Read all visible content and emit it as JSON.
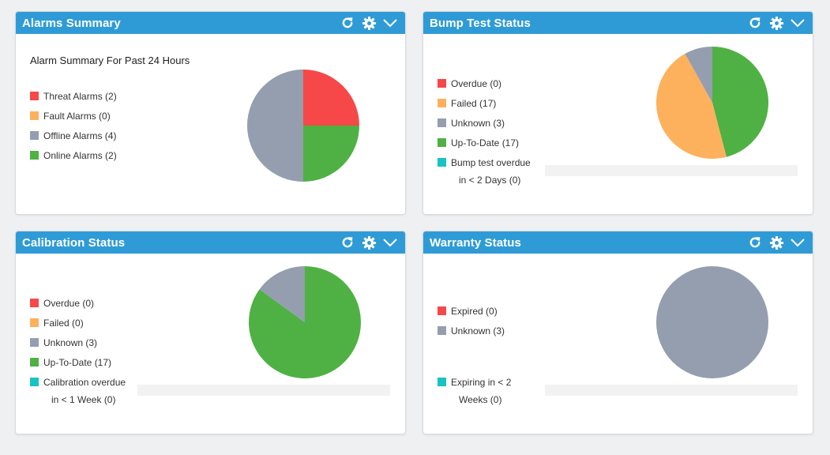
{
  "colors": {
    "header_bg": "#2f9bd6",
    "red": "#f64848",
    "orange": "#fdb15c",
    "gray": "#949eae",
    "green": "#4fb143",
    "teal": "#18c3c3"
  },
  "icons": {
    "refresh": "refresh-icon",
    "settings": "gear-icon",
    "collapse": "chevron-down-icon"
  },
  "panels": {
    "alarms": {
      "title": "Alarms Summary",
      "caption": "Alarm Summary For Past 24 Hours",
      "legend": [
        {
          "label": "Threat Alarms (2)",
          "color": "#f64848"
        },
        {
          "label": "Fault Alarms (0)",
          "color": "#fdb15c"
        },
        {
          "label": "Offline Alarms (4)",
          "color": "#949eae"
        },
        {
          "label": "Online Alarms (2)",
          "color": "#4fb143"
        }
      ]
    },
    "bump": {
      "title": "Bump Test Status",
      "legend": [
        {
          "label": "Overdue (0)",
          "color": "#f64848"
        },
        {
          "label": "Failed (17)",
          "color": "#fdb15c"
        },
        {
          "label": "Unknown (3)",
          "color": "#949eae"
        },
        {
          "label": "Up-To-Date (17)",
          "color": "#4fb143"
        },
        {
          "label": "Bump test overdue",
          "label2": "in < 2 Days (0)",
          "color": "#18c3c3"
        }
      ]
    },
    "calibration": {
      "title": "Calibration Status",
      "legend": [
        {
          "label": "Overdue (0)",
          "color": "#f64848"
        },
        {
          "label": "Failed (0)",
          "color": "#fdb15c"
        },
        {
          "label": "Unknown (3)",
          "color": "#949eae"
        },
        {
          "label": "Up-To-Date (17)",
          "color": "#4fb143"
        },
        {
          "label": "Calibration overdue",
          "label2": "in < 1 Week (0)",
          "color": "#18c3c3"
        }
      ]
    },
    "warranty": {
      "title": "Warranty Status",
      "legend": [
        {
          "label": "Expired (0)",
          "color": "#f64848"
        },
        {
          "label": "Unknown (3)",
          "color": "#949eae"
        },
        {
          "label": "Expiring in < 2",
          "label2": "Weeks (0)",
          "color": "#18c3c3"
        }
      ]
    }
  },
  "chart_data": [
    {
      "type": "pie",
      "slices": [
        {
          "label": "Threat Alarms",
          "value": 2,
          "color": "#f64848"
        },
        {
          "label": "Fault Alarms",
          "value": 0,
          "color": "#fdb15c"
        },
        {
          "label": "Offline Alarms",
          "value": 4,
          "color": "#949eae"
        },
        {
          "label": "Online Alarms",
          "value": 2,
          "color": "#4fb143"
        }
      ],
      "order": [
        "Threat Alarms",
        "Online Alarms",
        "Offline Alarms"
      ]
    },
    {
      "type": "pie",
      "slices": [
        {
          "label": "Overdue",
          "value": 0,
          "color": "#f64848"
        },
        {
          "label": "Failed",
          "value": 17,
          "color": "#fdb15c"
        },
        {
          "label": "Unknown",
          "value": 3,
          "color": "#949eae"
        },
        {
          "label": "Up-To-Date",
          "value": 17,
          "color": "#4fb143"
        },
        {
          "label": "Bump test overdue in < 2 Days",
          "value": 0,
          "color": "#18c3c3"
        }
      ],
      "order": [
        "Up-To-Date",
        "Failed",
        "Unknown"
      ]
    },
    {
      "type": "pie",
      "slices": [
        {
          "label": "Overdue",
          "value": 0,
          "color": "#f64848"
        },
        {
          "label": "Failed",
          "value": 0,
          "color": "#fdb15c"
        },
        {
          "label": "Unknown",
          "value": 3,
          "color": "#949eae"
        },
        {
          "label": "Up-To-Date",
          "value": 17,
          "color": "#4fb143"
        },
        {
          "label": "Calibration overdue in < 1 Week",
          "value": 0,
          "color": "#18c3c3"
        }
      ],
      "order": [
        "Up-To-Date",
        "Unknown"
      ]
    },
    {
      "type": "pie",
      "slices": [
        {
          "label": "Expired",
          "value": 0,
          "color": "#f64848"
        },
        {
          "label": "Unknown",
          "value": 3,
          "color": "#949eae"
        },
        {
          "label": "Expiring in < 2 Weeks",
          "value": 0,
          "color": "#18c3c3"
        }
      ],
      "order": [
        "Unknown"
      ]
    }
  ]
}
